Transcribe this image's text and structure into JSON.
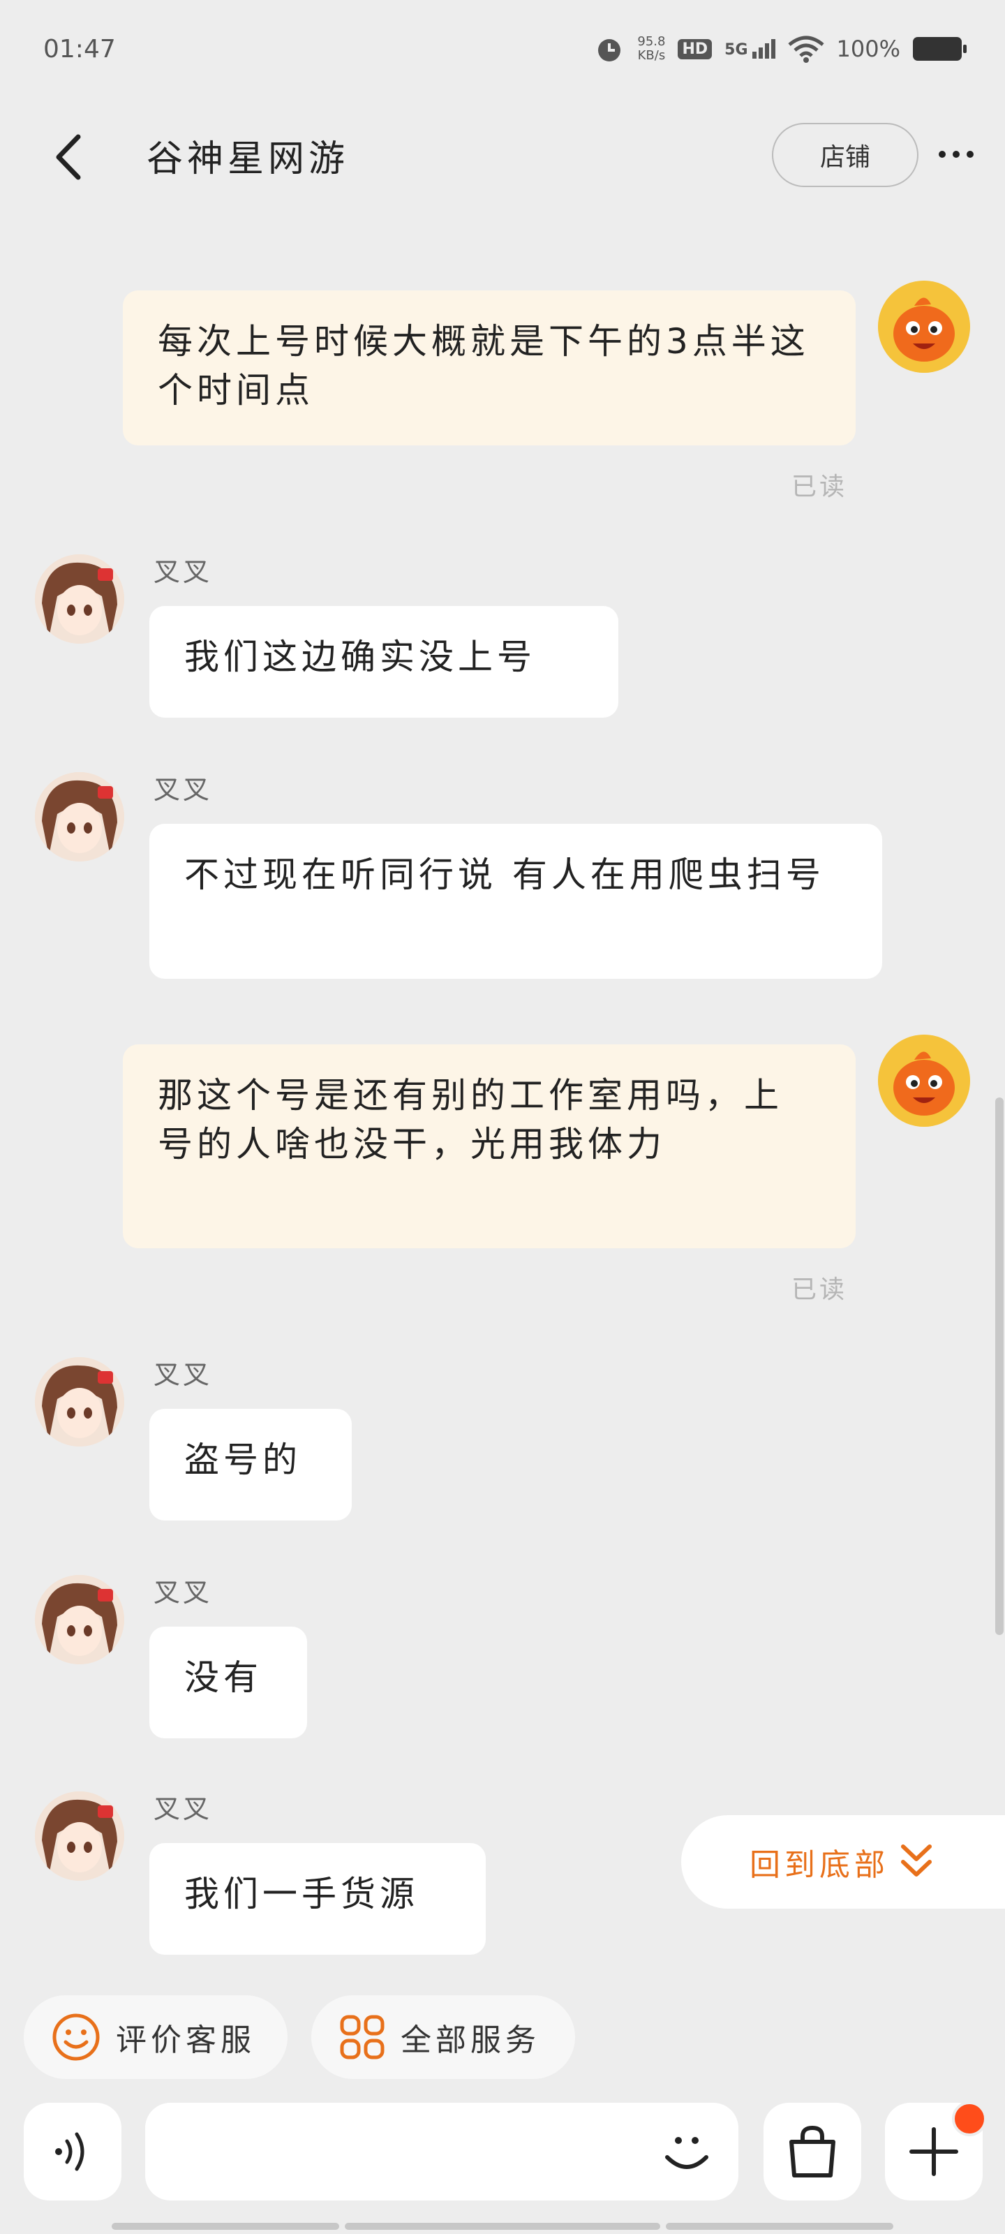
{
  "status_bar": {
    "time": "01:47",
    "net_speed_value": "95.8",
    "net_speed_unit": "KB/s",
    "hd": "HD",
    "signal": "5G",
    "battery": "100%"
  },
  "header": {
    "title": "谷神星网游",
    "shop_label": "店铺"
  },
  "messages": [
    {
      "from": "me",
      "text": "每次上号时候大概就是下午的3点半这个时间点",
      "status": "已读"
    },
    {
      "from": "other",
      "sender": "叉叉",
      "text": "我们这边确实没上号"
    },
    {
      "from": "other",
      "sender": "叉叉",
      "text": "不过现在听同行说 有人在用爬虫扫号"
    },
    {
      "from": "me",
      "text": "那这个号是还有别的工作室用吗，上号的人啥也没干，光用我体力",
      "status": "已读"
    },
    {
      "from": "other",
      "sender": "叉叉",
      "text": "盗号的"
    },
    {
      "from": "other",
      "sender": "叉叉",
      "text": "没有"
    },
    {
      "from": "other",
      "sender": "叉叉",
      "text": "我们一手货源"
    }
  ],
  "back_to_bottom": "回到底部",
  "quick_actions": {
    "rate_service": "评价客服",
    "all_services": "全部服务"
  },
  "input": {
    "placeholder": ""
  },
  "colors": {
    "accent": "#e8701a",
    "background": "#ededed",
    "my_bubble": "#fdf5e7",
    "their_bubble": "#ffffff",
    "badge": "#ff4d1a"
  },
  "icons": [
    "back-arrow-icon",
    "more-icon",
    "voice-icon",
    "emoji-icon",
    "shopping-bag-icon",
    "plus-icon",
    "smile-icon",
    "grid-icon",
    "double-chevron-down-icon"
  ]
}
